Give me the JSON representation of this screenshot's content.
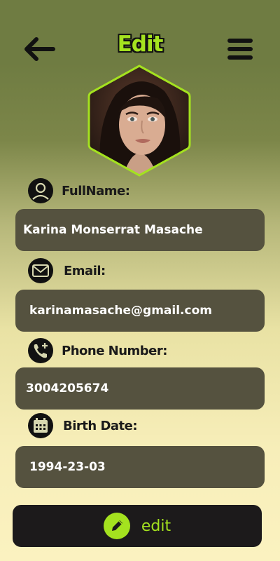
{
  "header": {
    "title": "Edit",
    "back_icon": "arrow-left-icon",
    "menu_icon": "hamburger-menu-icon"
  },
  "profile": {
    "avatar_icon": "profile-photo",
    "accent_color": "#a4e21f"
  },
  "fields": [
    {
      "label": "FullName:",
      "value": "Karina Monserrat Masache",
      "icon": "user-icon"
    },
    {
      "label": "Email:",
      "value": "karinamasache@gmail.com",
      "icon": "mail-icon"
    },
    {
      "label": "Phone Number:",
      "value": "3004205674",
      "icon": "phone-add-icon"
    },
    {
      "label": "Birth Date:",
      "value": "1994-23-03",
      "icon": "calendar-icon"
    }
  ],
  "actions": {
    "edit_label": "edit",
    "edit_icon": "pencil-icon"
  },
  "colors": {
    "accent": "#a4e21f",
    "field_background": "#55523f",
    "button_background": "#1c1a1b"
  }
}
